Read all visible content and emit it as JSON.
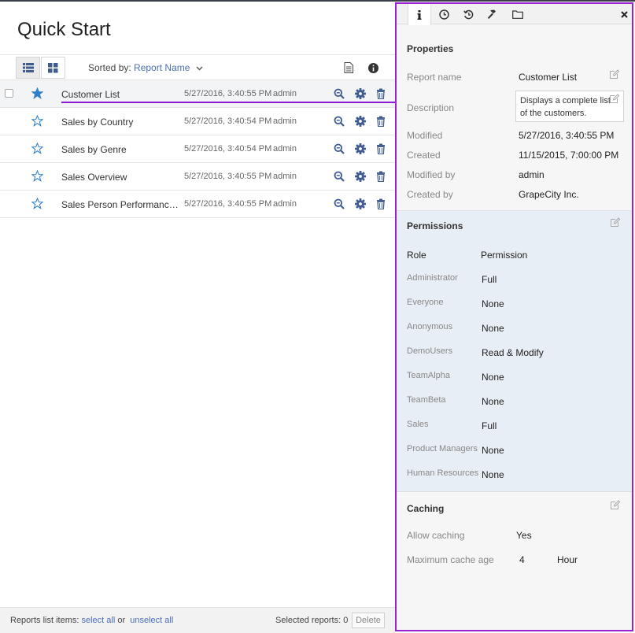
{
  "page": {
    "title": "Quick Start"
  },
  "toolbar": {
    "sorted_by_label": "Sorted by:",
    "sorted_by_value": "Report Name",
    "view_list_icon": "list-view-icon",
    "view_grid_icon": "grid-view-icon",
    "doc_icon": "document-icon",
    "info_icon": "info-icon"
  },
  "reports": [
    {
      "name": "Customer List",
      "modified": "5/27/2016, 3:40:55 PM",
      "user": "admin",
      "favorite": true,
      "selected": true
    },
    {
      "name": "Sales by Country",
      "modified": "5/27/2016, 3:40:54 PM",
      "user": "admin",
      "favorite": false,
      "selected": false
    },
    {
      "name": "Sales by Genre",
      "modified": "5/27/2016, 3:40:54 PM",
      "user": "admin",
      "favorite": false,
      "selected": false
    },
    {
      "name": "Sales Overview",
      "modified": "5/27/2016, 3:40:55 PM",
      "user": "admin",
      "favorite": false,
      "selected": false
    },
    {
      "name": "Sales Person Performance R...",
      "modified": "5/27/2016, 3:40:55 PM",
      "user": "admin",
      "favorite": false,
      "selected": false
    }
  ],
  "footer": {
    "items_label": "Reports list items:",
    "select_all": "select all",
    "or": "or",
    "unselect_all": "unselect all",
    "selected_label": "Selected reports: 0",
    "delete": "Delete"
  },
  "panel": {
    "tabs": [
      "info-icon",
      "clock-icon",
      "history-icon",
      "hammer-icon",
      "folder-icon"
    ],
    "close_icon": "close-icon",
    "properties": {
      "title": "Properties",
      "report_name_label": "Report name",
      "report_name": "Customer List",
      "description_label": "Description",
      "description": "Displays a complete list of the customers.",
      "modified_label": "Modified",
      "modified": "5/27/2016, 3:40:55 PM",
      "created_label": "Created",
      "created": "11/15/2015, 7:00:00 PM",
      "modified_by_label": "Modified by",
      "modified_by": "admin",
      "created_by_label": "Created by",
      "created_by": "GrapeCity Inc."
    },
    "permissions": {
      "title": "Permissions",
      "role_header": "Role",
      "permission_header": "Permission",
      "rows": [
        {
          "role": "Administrator",
          "permission": "Full"
        },
        {
          "role": "Everyone",
          "permission": "None"
        },
        {
          "role": "Anonymous",
          "permission": "None"
        },
        {
          "role": "DemoUsers",
          "permission": "Read & Modify"
        },
        {
          "role": "TeamAlpha",
          "permission": "None"
        },
        {
          "role": "TeamBeta",
          "permission": "None"
        },
        {
          "role": "Sales",
          "permission": "Full"
        },
        {
          "role": "Product Managers",
          "permission": "None"
        },
        {
          "role": "Human Resources",
          "permission": "None"
        }
      ]
    },
    "caching": {
      "title": "Caching",
      "allow_label": "Allow caching",
      "allow_value": "Yes",
      "max_age_label": "Maximum cache age",
      "max_age_value": "4",
      "max_age_unit": "Hour"
    }
  },
  "colors": {
    "accent": "#4a6fb5",
    "highlight": "#9b22d1",
    "star": "#2f80c9",
    "icon": "#3f5b8f"
  }
}
